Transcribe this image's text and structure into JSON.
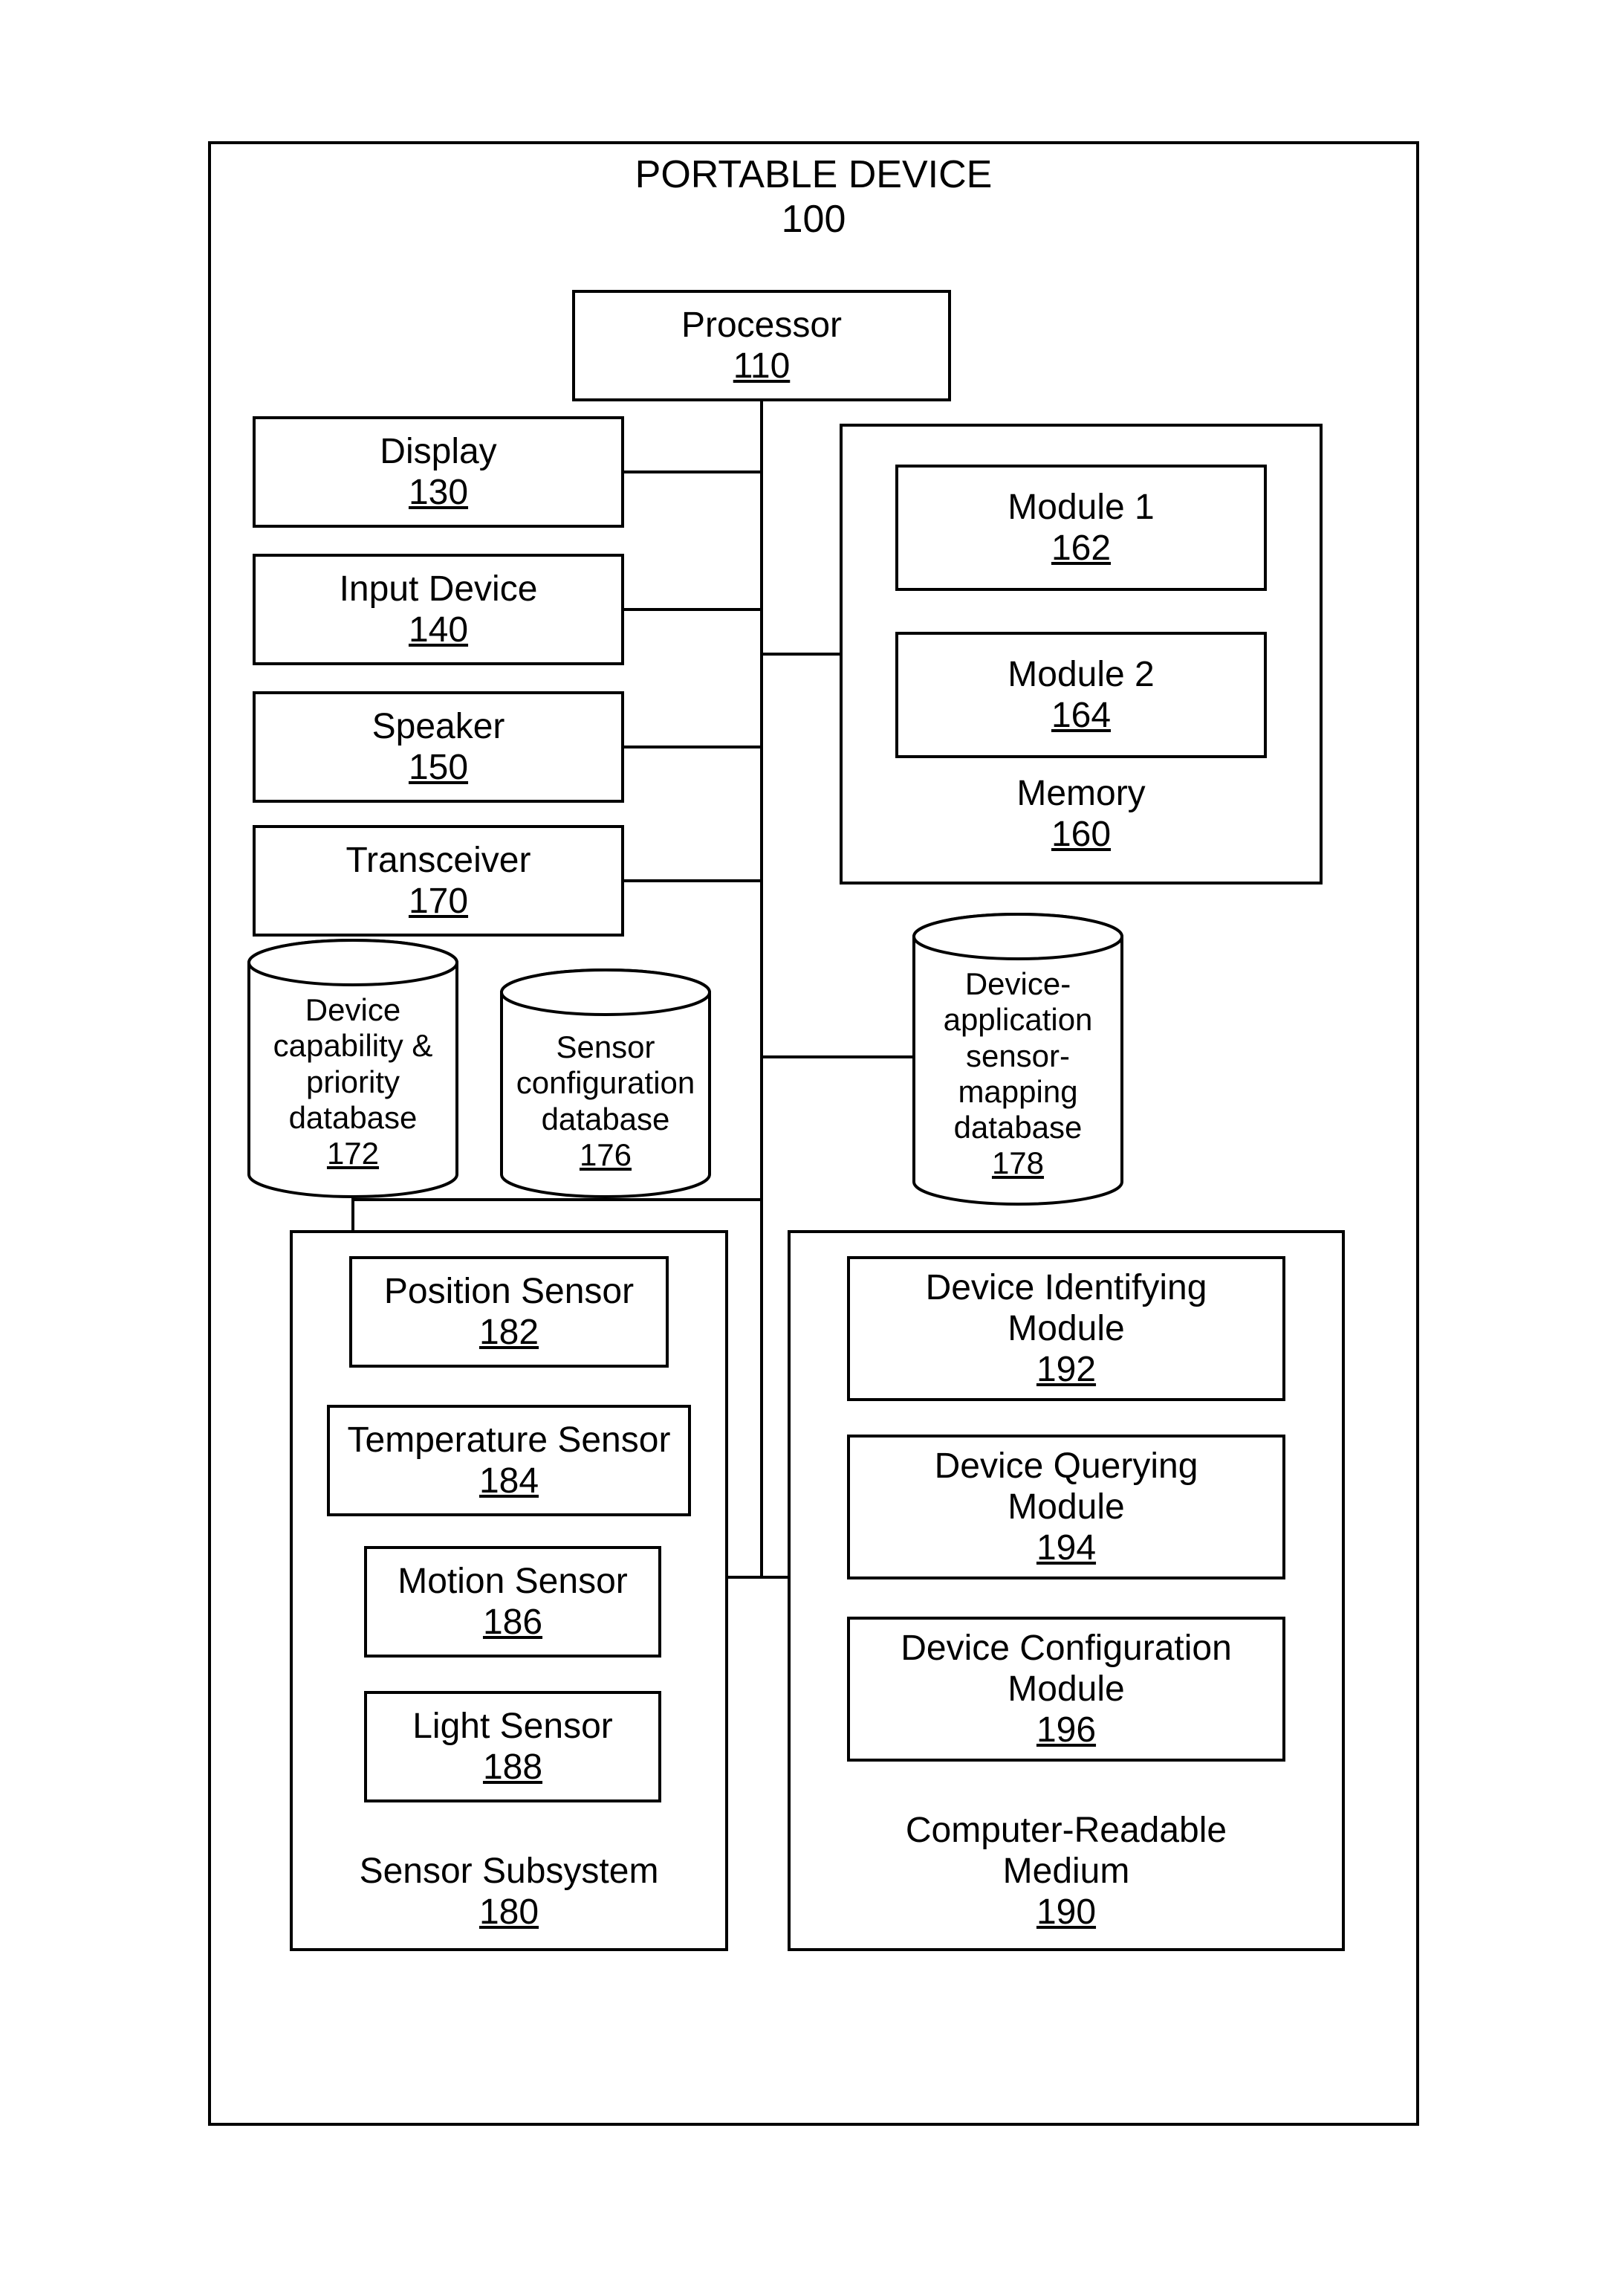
{
  "outer": {
    "title": "PORTABLE DEVICE",
    "num": "100"
  },
  "processor": {
    "label": "Processor",
    "num": "110"
  },
  "display": {
    "label": "Display",
    "num": "130"
  },
  "input": {
    "label": "Input Device",
    "num": "140"
  },
  "speaker": {
    "label": "Speaker",
    "num": "150"
  },
  "transceiver": {
    "label": "Transceiver",
    "num": "170"
  },
  "memory": {
    "label": "Memory",
    "num": "160"
  },
  "module1": {
    "label": "Module 1",
    "num": "162"
  },
  "module2": {
    "label": "Module 2",
    "num": "164"
  },
  "db1": {
    "l1": "Device",
    "l2": "capability &",
    "l3": "priority",
    "l4": "database",
    "num": "172"
  },
  "db2": {
    "l1": "Sensor",
    "l2": "configuration",
    "l3": "database",
    "num": "176"
  },
  "db3": {
    "l1": "Device-",
    "l2": "application",
    "l3": "sensor-",
    "l4": "mapping",
    "l5": "database",
    "num": "178"
  },
  "sensorSub": {
    "label": "Sensor Subsystem",
    "num": "180"
  },
  "pos": {
    "label": "Position Sensor",
    "num": "182"
  },
  "temp": {
    "label": "Temperature Sensor",
    "num": "184"
  },
  "motion": {
    "label": "Motion Sensor",
    "num": "186"
  },
  "light": {
    "label": "Light Sensor",
    "num": "188"
  },
  "crm": {
    "label": "Computer-Readable",
    "label2": "Medium",
    "num": "190"
  },
  "devId": {
    "label": "Device Identifying",
    "label2": "Module",
    "num": "192"
  },
  "devQ": {
    "label": "Device Querying",
    "label2": "Module",
    "num": "194"
  },
  "devCfg": {
    "label": "Device Configuration",
    "label2": "Module",
    "num": "196"
  }
}
